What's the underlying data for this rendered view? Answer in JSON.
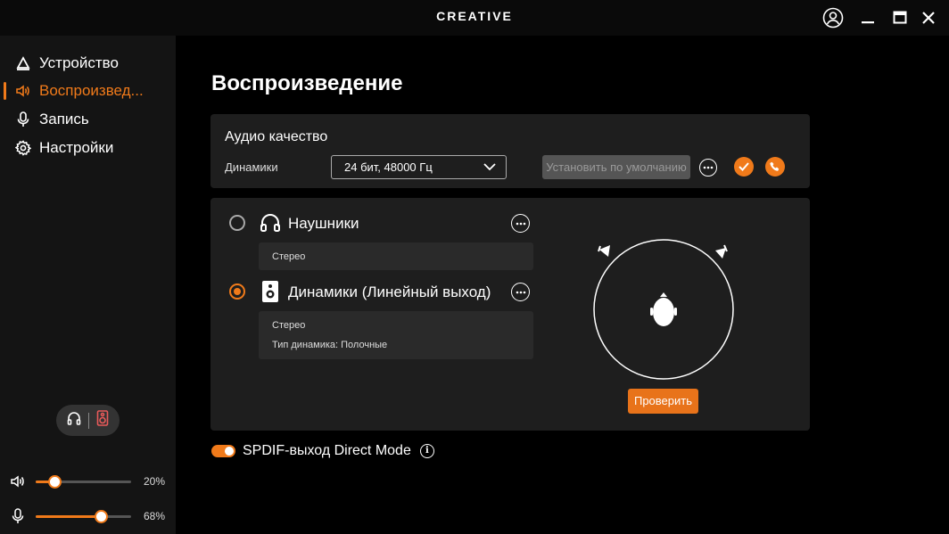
{
  "window": {
    "brand": "CREATIVE"
  },
  "sidebar": {
    "items": [
      {
        "label": "Устройство",
        "icon": "device-triangle-icon"
      },
      {
        "label": "Воспроизвед...",
        "icon": "speaker-sound-icon"
      },
      {
        "label": "Запись",
        "icon": "microphone-icon"
      },
      {
        "label": "Настройки",
        "icon": "gear-icon"
      }
    ],
    "active_index": 1,
    "output_toggle": {
      "left_icon": "headphones-icon",
      "right_icon": "speaker-icon"
    },
    "volume": {
      "playback_pct": 20,
      "playback_label": "20%",
      "record_pct": 68,
      "record_label": "68%"
    }
  },
  "main": {
    "title": "Воспроизведение",
    "quality": {
      "title": "Аудио качество",
      "device_label": "Динамики",
      "format_value": "24 бит, 48000 Гц",
      "set_default_label": "Установить по умолчанию"
    },
    "devices": [
      {
        "name": "Наушники",
        "selected": false,
        "icon": "headphones-icon",
        "info": [
          "Стерео"
        ]
      },
      {
        "name": "Динамики (Линейный выход)",
        "selected": true,
        "icon": "speaker-icon",
        "info": [
          "Стерео",
          "Тип динамика:  Полочные"
        ]
      }
    ],
    "test_button": "Проверить",
    "spdif": {
      "label": "SPDIF-выход Direct Mode",
      "enabled": true
    }
  },
  "colors": {
    "accent": "#f07a1a",
    "background": "#000000",
    "panel": "#1e1e1e",
    "sidebar": "#141414"
  }
}
